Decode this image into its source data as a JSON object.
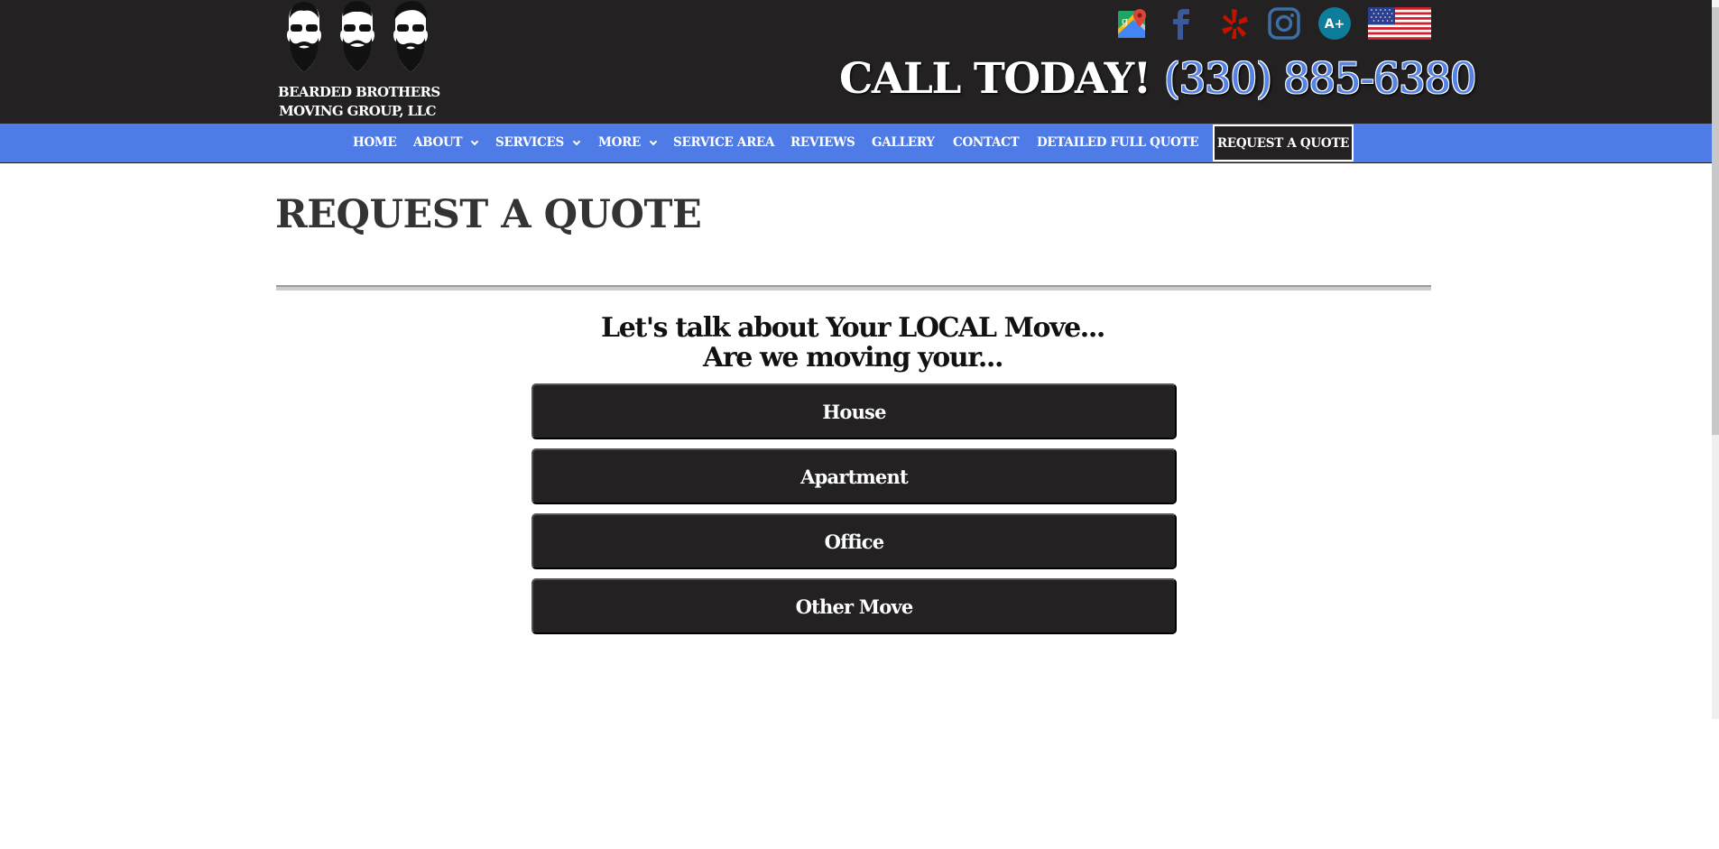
{
  "brand": {
    "name_line1": "BEARDED BROTHERS",
    "name_line2": "MOVING GROUP, LLC",
    "logo_icon": "three-bearded-faces-logo"
  },
  "header": {
    "social_icons": [
      {
        "name": "google-maps-icon",
        "label": "Google Maps"
      },
      {
        "name": "facebook-icon",
        "label": "Facebook"
      },
      {
        "name": "yelp-icon",
        "label": "Yelp"
      },
      {
        "name": "instagram-icon",
        "label": "Instagram"
      },
      {
        "name": "bbb-rating-icon",
        "label": "A+"
      },
      {
        "name": "us-flag-icon",
        "label": "USA"
      }
    ],
    "cta_text": "CALL TODAY!",
    "phone": "(330) 885-6380"
  },
  "nav": {
    "items": [
      {
        "label": "HOME",
        "dropdown": false
      },
      {
        "label": "ABOUT",
        "dropdown": true
      },
      {
        "label": "SERVICES",
        "dropdown": true
      },
      {
        "label": "MORE",
        "dropdown": true
      },
      {
        "label": "SERVICE AREA",
        "dropdown": false
      },
      {
        "label": "REVIEWS",
        "dropdown": false
      },
      {
        "label": "GALLERY",
        "dropdown": false
      },
      {
        "label": "CONTACT",
        "dropdown": false
      },
      {
        "label": "DETAILED FULL QUOTE",
        "dropdown": false
      }
    ],
    "cta_label": "REQUEST A QUOTE"
  },
  "main": {
    "page_title": "REQUEST A QUOTE",
    "question_line1": "Let's talk about Your LOCAL Move...",
    "question_line2": "Are we moving your...",
    "options": [
      "House",
      "Apartment",
      "Office",
      "Other Move"
    ]
  },
  "colors": {
    "header_bg": "#232122",
    "nav_bg": "#4f7be6",
    "phone": "#5583e5",
    "button_bg": "#232122",
    "title": "#333333"
  }
}
